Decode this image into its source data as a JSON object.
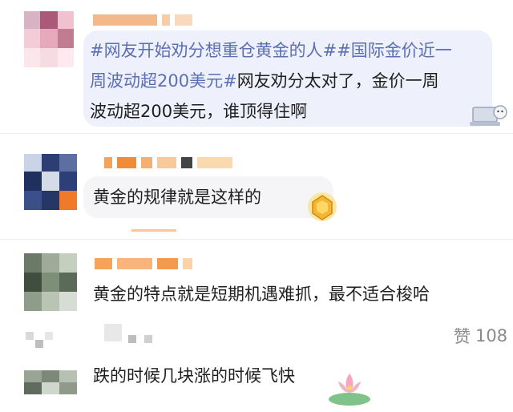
{
  "comments": [
    {
      "id": "c1",
      "segments": [
        {
          "text": "#网友开始劝分想重仓黄金的人##国际金价近一",
          "topic": true
        },
        {
          "text": "周波动超200美元#网友劝分太对了，金价一周",
          "mixed": true
        },
        {
          "text": "波动超200美元，谁顶得住啊",
          "topic": false
        }
      ],
      "sticker": "laptop-sticker-icon"
    },
    {
      "id": "c2",
      "text": "黄金的规律就是这样的",
      "sticker": "gold-badge-icon"
    },
    {
      "id": "c3",
      "text": "黄金的特点就是短期机遇难抓，最不适合梭哈",
      "likes_label": "赞",
      "likes_count": "108"
    },
    {
      "id": "c4",
      "text": "跌的时候几块涨的时候飞快",
      "sticker": "lotus-sticker-icon"
    }
  ],
  "colors": {
    "bubble_c1": "#eef0fb",
    "bubble_c2": "#f5f5f8",
    "topic_blue": "#5b6fb3",
    "text_dark": "#1f1f1f",
    "muted": "#8a8a8a"
  }
}
